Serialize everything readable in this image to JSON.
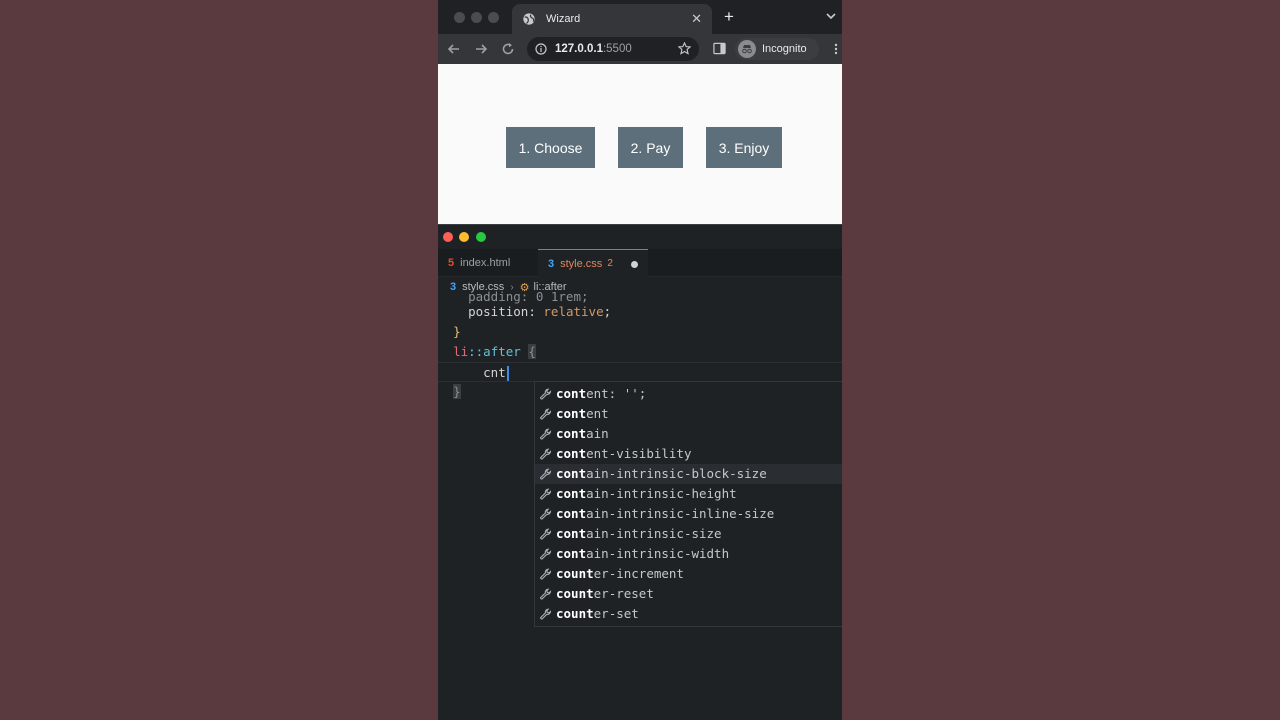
{
  "browser": {
    "tab_title": "Wizard",
    "url_host": "127.0.0.1",
    "url_port": ":5500",
    "incognito_label": "Incognito",
    "steps": [
      "1. Choose",
      "2. Pay",
      "3. Enjoy"
    ],
    "step_color": "#5e6f7c"
  },
  "editor": {
    "tabs": [
      {
        "label": "index.html"
      },
      {
        "label": "style.css",
        "badge": "2"
      }
    ],
    "breadcrumbs": {
      "file": "style.css",
      "symbol": "li::after"
    },
    "code": {
      "partial": "    padding: 0 1rem;",
      "prop": "position",
      "val": "relative",
      "close": "}",
      "selector": "li",
      "pseudo": "::after",
      "open": "{",
      "typed": "cnt",
      "end_brace": "}"
    },
    "suggestions": [
      {
        "match": "cont",
        "rest": "ent: '';"
      },
      {
        "match": "cont",
        "rest": "ent"
      },
      {
        "match": "cont",
        "rest": "ain"
      },
      {
        "match": "cont",
        "rest": "ent-visibility"
      },
      {
        "match": "cont",
        "rest": "ain-intrinsic-block-size"
      },
      {
        "match": "cont",
        "rest": "ain-intrinsic-height"
      },
      {
        "match": "cont",
        "rest": "ain-intrinsic-inline-size"
      },
      {
        "match": "cont",
        "rest": "ain-intrinsic-size"
      },
      {
        "match": "cont",
        "rest": "ain-intrinsic-width"
      },
      {
        "match": "count",
        "rest": "er-increment"
      },
      {
        "match": "count",
        "rest": "er-reset"
      },
      {
        "match": "count",
        "rest": "er-set"
      }
    ]
  }
}
